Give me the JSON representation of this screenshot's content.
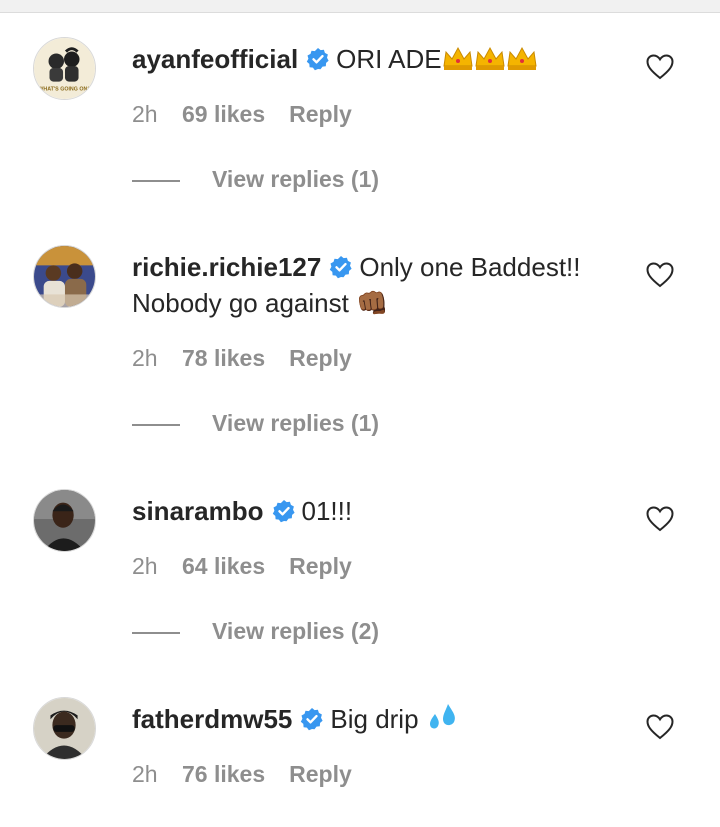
{
  "comments": [
    {
      "username": "ayanfeofficial",
      "text": "ORI ADE",
      "emoji": [
        "crown",
        "crown",
        "crown"
      ],
      "time": "2h",
      "likes": "69 likes",
      "reply_label": "Reply",
      "view_replies": "View replies (1)",
      "avatar_caption": "WHAT'S GOING ON?"
    },
    {
      "username": "richie.richie127",
      "text": "Only one Baddest!! Nobody go against 👊🏾",
      "time": "2h",
      "likes": "78 likes",
      "reply_label": "Reply",
      "view_replies": "View replies (1)"
    },
    {
      "username": "sinarambo",
      "text": "01!!!",
      "time": "2h",
      "likes": "64 likes",
      "reply_label": "Reply",
      "view_replies": "View replies (2)"
    },
    {
      "username": "fatherdmw55",
      "text": "Big drip",
      "emoji": [
        "droplets"
      ],
      "time": "2h",
      "likes": "76 likes",
      "reply_label": "Reply"
    }
  ],
  "colors": {
    "text": "#262626",
    "muted": "#8e8e8e",
    "verified": "#3897f0",
    "crown": "#f5b400",
    "drip": "#40b4f0"
  },
  "icons": {
    "verified": "verified-badge-icon",
    "like": "heart-outline-icon"
  }
}
